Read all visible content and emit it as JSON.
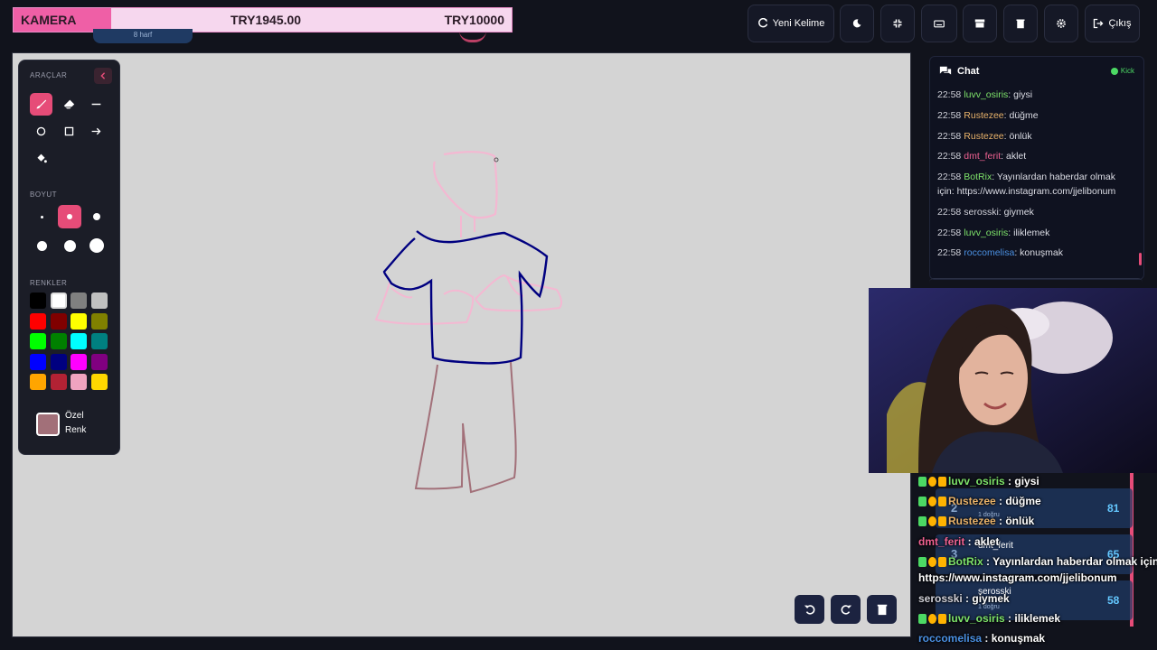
{
  "banner": {
    "left_label": "KAMERA",
    "current_amount": "TRY1945.00",
    "goal_amount": "TRY10000",
    "hint": "8 harf"
  },
  "top_buttons": {
    "new_word": "Yeni Kelime",
    "exit": "Çıkış"
  },
  "tools": {
    "title": "ARAÇLAR",
    "size_title": "BOYUT",
    "colors_title": "RENKLER",
    "custom_color_label": "Özel Renk",
    "items": [
      "brush-icon",
      "eraser-icon",
      "line-icon",
      "circle-icon",
      "rectangle-icon",
      "arrow-icon",
      "fill-icon"
    ],
    "active_tool": "brush",
    "active_size_index": 1,
    "palette": [
      "#000000",
      "#ffffff",
      "#808080",
      "#c0c0c0",
      "#ff0000",
      "#800000",
      "#ffff00",
      "#808000",
      "#00ff00",
      "#008000",
      "#00ffff",
      "#008080",
      "#0000ff",
      "#000080",
      "#ff00ff",
      "#800080",
      "#ffa500",
      "#b22234",
      "#f0a3c0",
      "#ffd700"
    ],
    "custom_color": "#a27079"
  },
  "chat": {
    "title": "Chat",
    "platform": "Kick",
    "messages": [
      {
        "time": "22:58",
        "user": "luvv_osiris",
        "color": "#7ee36a",
        "text": ": giysi"
      },
      {
        "time": "22:58",
        "user": "Rustezee",
        "color": "#e8b26a",
        "text": ": düğme"
      },
      {
        "time": "22:58",
        "user": "Rustezee",
        "color": "#e8b26a",
        "text": ": önlük"
      },
      {
        "time": "22:58",
        "user": "dmt_ferit",
        "color": "#f06292",
        "text": ": aklet"
      },
      {
        "time": "22:58",
        "user": "BotRix",
        "color": "#7ee36a",
        "text": ": Yayınlardan haberdar olmak için: https://www.instagram.com/jjelibonum"
      },
      {
        "time": "22:58",
        "user": "serosski",
        "color": "#d0d0d8",
        "text": ": giymek"
      },
      {
        "time": "22:58",
        "user": "luvv_osiris",
        "color": "#7ee36a",
        "text": ": iliklemek"
      },
      {
        "time": "22:58",
        "user": "roccomelisa",
        "color": "#4a90e2",
        "text": ": konuşmak"
      }
    ]
  },
  "leaderboard": [
    {
      "rank": "2",
      "name": "",
      "sub": "1 doğru",
      "score": "81"
    },
    {
      "rank": "3",
      "name": "dmt_ferit",
      "sub": "",
      "score": "65"
    },
    {
      "rank": "",
      "name": "serosski",
      "sub": "1 doğru",
      "score": "58"
    }
  ],
  "overlay_chat": [
    {
      "user": "luvv_osiris",
      "color": "#7ee36a",
      "text": " : giysi",
      "badges": true
    },
    {
      "user": "Rustezee",
      "color": "#e8b26a",
      "text": " : düğme",
      "badges": true
    },
    {
      "user": "Rustezee",
      "color": "#e8b26a",
      "text": " : önlük",
      "badges": true
    },
    {
      "user": "dmt_ferit",
      "color": "#f06292",
      "text": " : aklet",
      "badges": false
    },
    {
      "user": "BotRix",
      "color": "#7ee36a",
      "text": " : Yayınlardan haberdar olmak için:",
      "badges": true
    },
    {
      "user": "",
      "color": "#ffffff",
      "text": "https://www.instagram.com/jjelibonum",
      "badges": false
    },
    {
      "user": "serosski",
      "color": "#d0d0d8",
      "text": " : giymek",
      "badges": false
    },
    {
      "user": "luvv_osiris",
      "color": "#7ee36a",
      "text": " : iliklemek",
      "badges": true
    },
    {
      "user": "roccomelisa",
      "color": "#4a90e2",
      "text": " : konuşmak",
      "badges": false
    }
  ],
  "colors": {
    "accent": "#e64c78",
    "stroke_pink": "#f4b8d2",
    "stroke_navy": "#000080",
    "stroke_mauve": "#a27079"
  }
}
